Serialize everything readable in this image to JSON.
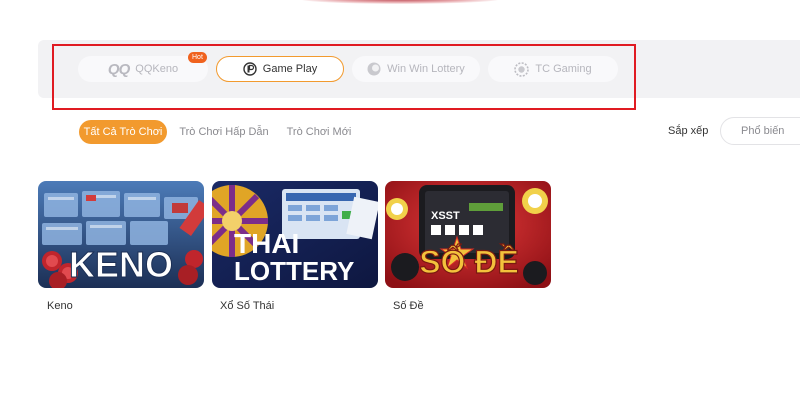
{
  "providers": [
    {
      "label": "QQKeno",
      "logo_text": "QQ",
      "badge": "Hot",
      "active": false
    },
    {
      "label": "Game Play",
      "active": true
    },
    {
      "label": "Win Win Lottery",
      "active": false
    },
    {
      "label": "TC Gaming",
      "active": false
    }
  ],
  "tabs": [
    {
      "label": "Tất Cả Trò Chơi",
      "active": true
    },
    {
      "label": "Trò Chơi Hấp Dẫn",
      "active": false
    },
    {
      "label": "Trò Chơi Mới",
      "active": false
    }
  ],
  "sort": {
    "label": "Sắp xếp",
    "value": "Phổ biến"
  },
  "games": [
    {
      "title": "Keno",
      "banner_text": "KENO"
    },
    {
      "title": "Xổ Số Thái",
      "banner_line1": "THAI",
      "banner_line2": "LOTTERY"
    },
    {
      "title": "Số Đề",
      "banner_text": "SỐ ĐỀ",
      "screen_text": "XSST"
    }
  ],
  "colors": {
    "accent": "#f29a2e",
    "highlight_border": "#e01b22",
    "hot_badge": "#f0621e"
  }
}
